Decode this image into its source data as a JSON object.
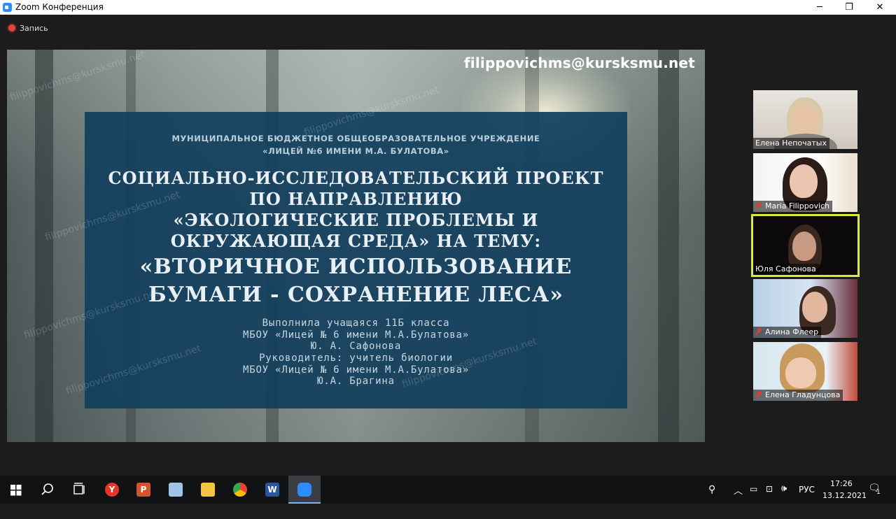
{
  "window": {
    "title": "Zoom Конференция",
    "minimize_glyph": "─",
    "restore_glyph": "❐",
    "close_glyph": "✕"
  },
  "recording": {
    "label": "Запись"
  },
  "slide": {
    "watermark_email": "filippovichms@kursksmu.net",
    "org_line1": "МУНИЦИПАЛЬНОЕ БЮДЖЕТНОЕ ОБЩЕОБРАЗОВАТЕЛЬНОЕ УЧРЕЖДЕНИЕ",
    "org_line2": "«ЛИЦЕЙ №6 ИМЕНИ М.А. БУЛАТОВА»",
    "title_lines": [
      "СОЦИАЛЬНО-ИССЛЕДОВАТЕЛЬСКИЙ ПРОЕКТ",
      "ПО НАПРАВЛЕНИЮ",
      "«ЭКОЛОГИЧЕСКИЕ ПРОБЛЕМЫ И",
      "ОКРУЖАЮЩАЯ СРЕДА» НА ТЕМУ:",
      "«ВТОРИЧНОЕ ИСПОЛЬЗОВАНИЕ",
      "БУМАГИ - СОХРАНЕНИЕ ЛЕСА»"
    ],
    "info_lines": [
      "Выполнила учащаяся 11Б класса",
      "МБОУ «Лицей № 6 имени М.А.Булатова»",
      "Ю. А. Сафонова",
      "Руководитель: учитель биологии",
      "МБОУ «Лицей № 6 имени М.А.Булатова»",
      "Ю.А. Брагина"
    ]
  },
  "participants": [
    {
      "name": "Елена Непочатых",
      "muted": false,
      "active": false
    },
    {
      "name": "Maria Filippovich",
      "muted": true,
      "active": false
    },
    {
      "name": "Юля Сафонова",
      "muted": false,
      "active": true
    },
    {
      "name": "Алина Флеер",
      "muted": true,
      "active": false
    },
    {
      "name": "Елена Гладунцова",
      "muted": true,
      "active": false
    }
  ],
  "taskbar": {
    "apps": [
      {
        "icon": "start-icon"
      },
      {
        "icon": "search-icon"
      },
      {
        "icon": "task-view-icon"
      },
      {
        "icon": "yandex-browser-icon",
        "glyph": "Y",
        "color": "#e8332a"
      },
      {
        "icon": "powerpoint-icon",
        "glyph": "P",
        "color": "#d35230"
      },
      {
        "icon": "notepad-icon",
        "glyph": "",
        "color": "#9fc4e8"
      },
      {
        "icon": "file-explorer-icon",
        "glyph": "",
        "color": "#f4c542"
      },
      {
        "icon": "chrome-icon",
        "glyph": "",
        "color": "#3aa757"
      },
      {
        "icon": "word-icon",
        "glyph": "W",
        "color": "#2b579a"
      },
      {
        "icon": "zoom-icon",
        "glyph": "",
        "color": "#2d8cff"
      }
    ],
    "language": "РУС",
    "time": "17:26",
    "date": "13.12.2021",
    "notification_count": "1"
  }
}
